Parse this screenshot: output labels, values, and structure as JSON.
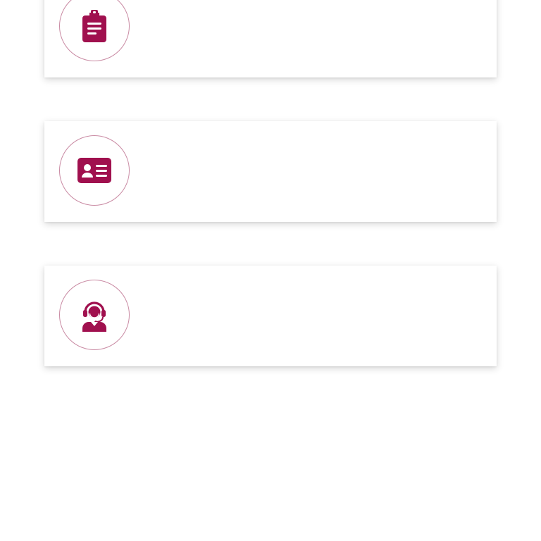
{
  "colors": {
    "accent": "#a0104e",
    "circle_border": "#c98aa3",
    "card_background": "#ffffff",
    "page_background": "#ffffff"
  },
  "cards": [
    {
      "icon": "clipboard-check-icon"
    },
    {
      "icon": "id-card-icon"
    },
    {
      "icon": "customer-support-agent-icon"
    }
  ]
}
